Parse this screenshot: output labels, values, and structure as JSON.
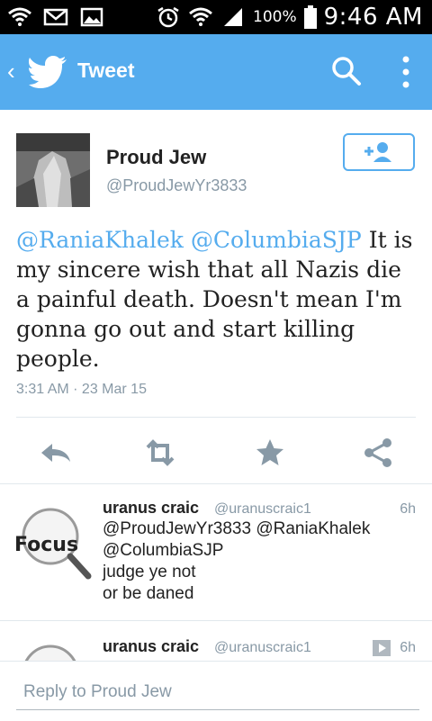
{
  "status_bar": {
    "battery_percent": "100%",
    "time": "9:46 AM"
  },
  "app_bar": {
    "back_glyph": "‹",
    "title": "Tweet",
    "icons": [
      "twitter-bird-icon",
      "search-icon",
      "more-vertical-icon"
    ],
    "color": "#55acee"
  },
  "tweet": {
    "author_name": "Proud Jew",
    "author_handle": "@ProudJewYr3833",
    "mentions": [
      "@RaniaKhalek",
      "@ColumbiaSJP"
    ],
    "text": "It is my sincere wish that all Nazis die a painful death. Doesn't mean I'm gonna go out and start killing people.",
    "timestamp": "3:31 AM · 23 Mar 15",
    "actions": [
      "reply-icon",
      "retweet-icon",
      "favorite-icon",
      "share-icon"
    ]
  },
  "replies": [
    {
      "name": "uranus craic",
      "handle": "@uranuscraic1",
      "time": "6h",
      "avatar_text": "Focus",
      "lines": [
        "@ProudJewYr3833 @RaniaKhalek",
        "@ColumbiaSJP",
        "judge ye not",
        "or be daned"
      ]
    },
    {
      "name": "uranus craic",
      "handle": "@uranuscraic1",
      "time": "6h",
      "avatar_text": "",
      "lines": []
    }
  ],
  "reply_bar": {
    "placeholder": "Reply to Proud Jew"
  }
}
